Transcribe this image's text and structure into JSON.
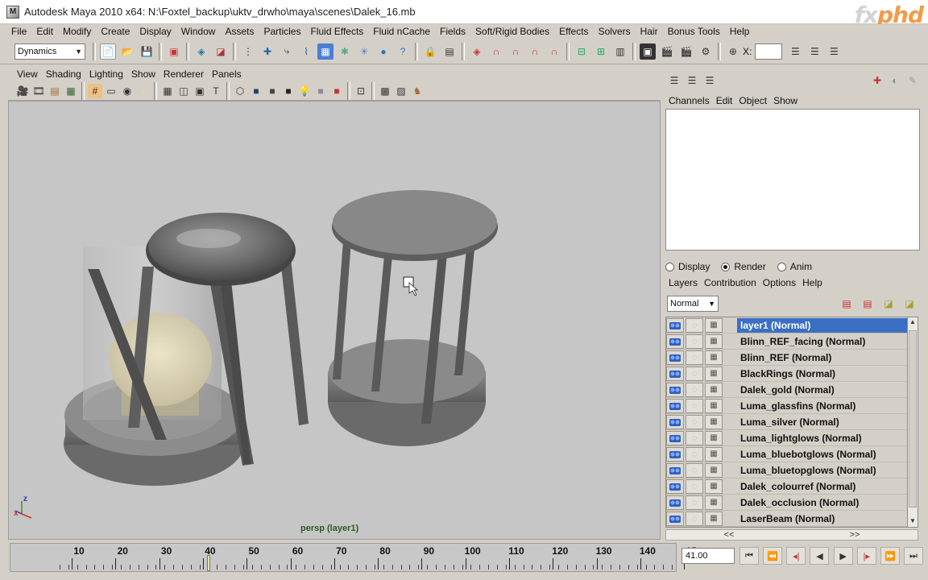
{
  "window": {
    "title": "Autodesk Maya 2010 x64: N:\\Foxtel_backup\\uktv_drwho\\maya\\scenes\\Dalek_16.mb",
    "watermark_lead": "fx",
    "watermark": "phd"
  },
  "menubar": [
    "File",
    "Edit",
    "Modify",
    "Create",
    "Display",
    "Window",
    "Assets",
    "Particles",
    "Fluid Effects",
    "Fluid nCache",
    "Fields",
    "Soft/Rigid Bodies",
    "Effects",
    "Solvers",
    "Hair",
    "Bonus Tools",
    "Help"
  ],
  "shelf": {
    "mode": "Dynamics",
    "field_prefix": "X:"
  },
  "panel": {
    "menus": [
      "View",
      "Shading",
      "Lighting",
      "Show",
      "Renderer",
      "Panels"
    ],
    "camera_label": "persp (layer1)",
    "axis": {
      "z": "z",
      "x": "x"
    }
  },
  "channel_box": {
    "menus": [
      "Channels",
      "Edit",
      "Object",
      "Show"
    ]
  },
  "layer_editor": {
    "modes": [
      {
        "label": "Display",
        "selected": false
      },
      {
        "label": "Render",
        "selected": true
      },
      {
        "label": "Anim",
        "selected": false
      }
    ],
    "menus": [
      "Layers",
      "Contribution",
      "Options",
      "Help"
    ],
    "blend_mode": "Normal",
    "layers": [
      "layer1 (Normal)",
      "Blinn_REF_facing (Normal)",
      "Blinn_REF (Normal)",
      "BlackRings (Normal)",
      "Dalek_gold (Normal)",
      "Luma_glassfins (Normal)",
      "Luma_silver (Normal)",
      "Luma_lightglows (Normal)",
      "Luma_bluebotglows (Normal)",
      "Luma_bluetopglows (Normal)",
      "Dalek_colourref (Normal)",
      "Dalek_occlusion (Normal)",
      "LaserBeam (Normal)"
    ],
    "selected_index": 0,
    "scroll_left": "<<",
    "scroll_right": ">>"
  },
  "timeline": {
    "labels": [
      "10",
      "20",
      "30",
      "40",
      "50",
      "60",
      "70",
      "80",
      "90",
      "100",
      "110",
      "120",
      "130",
      "140",
      "15"
    ],
    "current_frame": 41,
    "current_time": "41.00"
  },
  "colors": {
    "viewport_bg": "#c6c6c6",
    "selection": "#3a6fc4",
    "ui_bg": "#d4d0c8",
    "camera_label": "#2c5a1e"
  }
}
